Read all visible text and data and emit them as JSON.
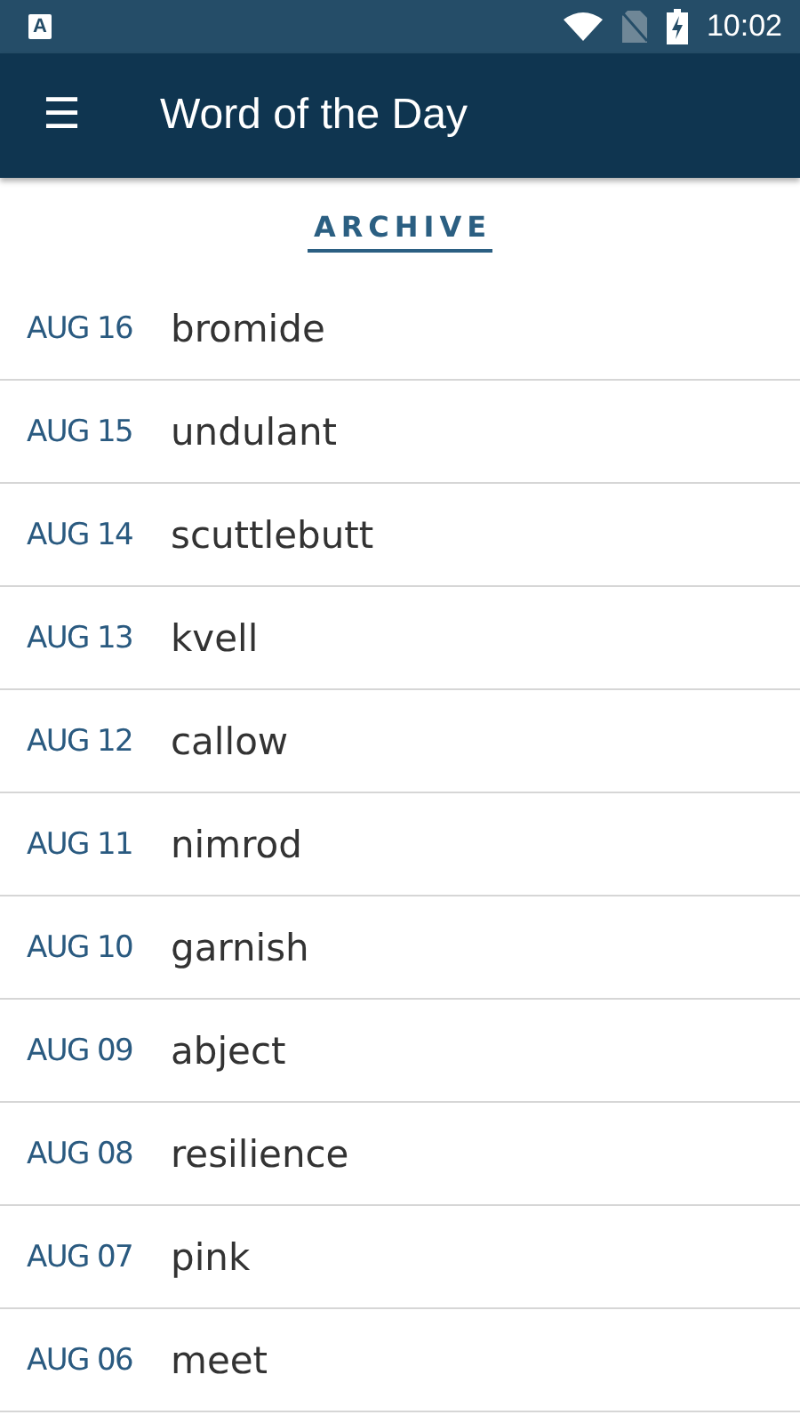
{
  "status_bar": {
    "notification_letter": "A",
    "time": "10:02"
  },
  "app_bar": {
    "menu_glyph": "☰",
    "title": "Word of the Day"
  },
  "section": {
    "title": "ARCHIVE"
  },
  "entries": [
    {
      "date": "AUG 16",
      "word": "bromide"
    },
    {
      "date": "AUG 15",
      "word": "undulant"
    },
    {
      "date": "AUG 14",
      "word": "scuttlebutt"
    },
    {
      "date": "AUG 13",
      "word": "kvell"
    },
    {
      "date": "AUG 12",
      "word": "callow"
    },
    {
      "date": "AUG 11",
      "word": "nimrod"
    },
    {
      "date": "AUG 10",
      "word": "garnish"
    },
    {
      "date": "AUG 09",
      "word": "abject"
    },
    {
      "date": "AUG 08",
      "word": "resilience"
    },
    {
      "date": "AUG 07",
      "word": "pink"
    },
    {
      "date": "AUG 06",
      "word": "meet"
    }
  ]
}
